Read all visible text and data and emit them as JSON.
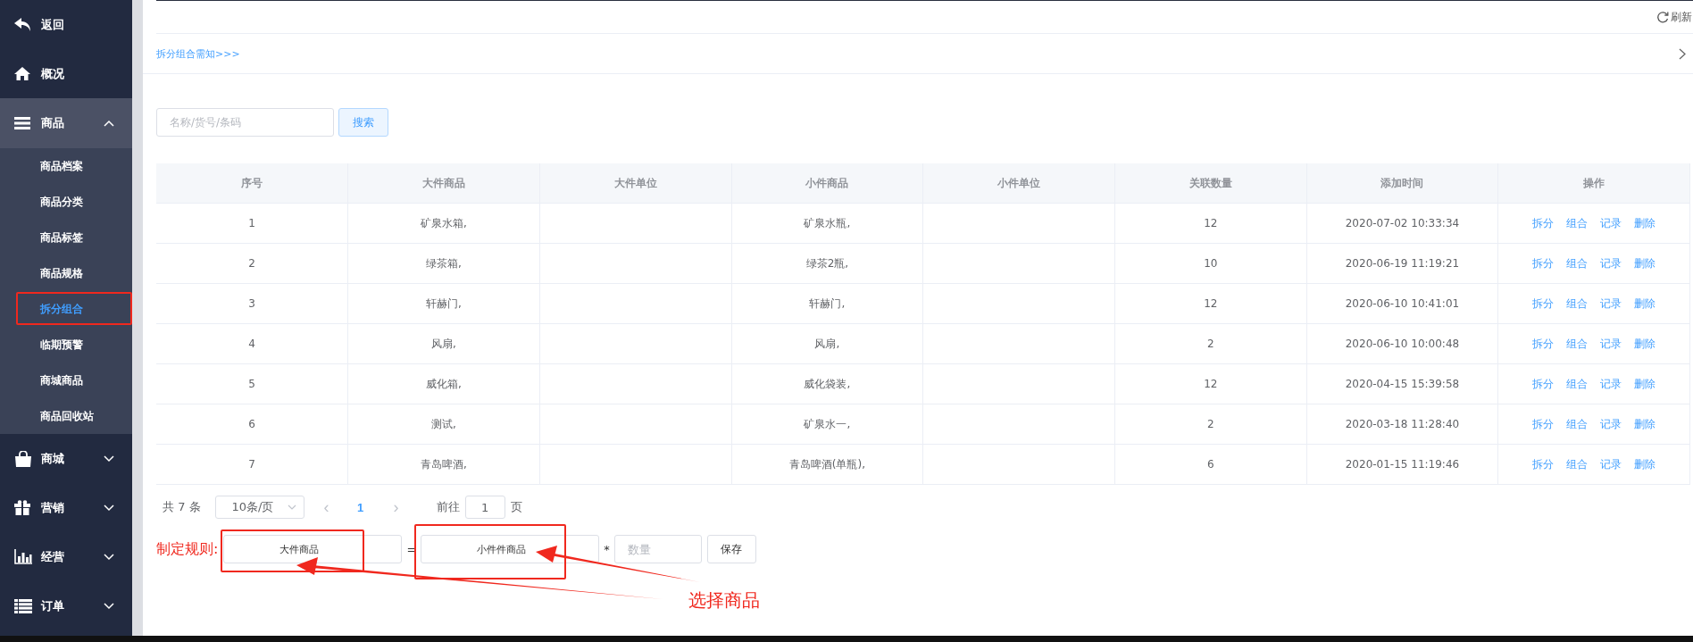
{
  "sidebar": {
    "items": [
      {
        "label": "返回"
      },
      {
        "label": "概况"
      },
      {
        "label": "商品",
        "expanded": true,
        "children": [
          {
            "label": "商品档案",
            "selected": false,
            "marked": false
          },
          {
            "label": "商品分类",
            "selected": false,
            "marked": false
          },
          {
            "label": "商品标签",
            "selected": false,
            "marked": false
          },
          {
            "label": "商品规格",
            "selected": false,
            "marked": false
          },
          {
            "label": "拆分组合",
            "selected": true,
            "marked": true
          },
          {
            "label": "临期预警",
            "selected": false,
            "marked": false
          },
          {
            "label": "商城商品",
            "selected": false,
            "marked": false
          },
          {
            "label": "商品回收站",
            "selected": false,
            "marked": false
          }
        ]
      },
      {
        "label": "商城",
        "expanded": false
      },
      {
        "label": "营销",
        "expanded": false
      },
      {
        "label": "经营",
        "expanded": false
      },
      {
        "label": "订单",
        "expanded": false
      }
    ]
  },
  "toolbar": {
    "refresh": "刷新"
  },
  "notice": {
    "link": "拆分组合需知>>>"
  },
  "search": {
    "placeholder": "名称/货号/条码",
    "button": "搜索"
  },
  "table": {
    "columns": [
      "序号",
      "大件商品",
      "大件单位",
      "小件商品",
      "小件单位",
      "关联数量",
      "添加时间",
      "操作"
    ],
    "rows": [
      {
        "no": "1",
        "big": "矿泉水箱,",
        "small": "矿泉水瓶,",
        "qty": "12",
        "time": "2020-07-02 10:33:34",
        "actions": [
          "拆分",
          "组合",
          "记录",
          "删除"
        ]
      },
      {
        "no": "2",
        "big": "绿茶箱,",
        "small": "绿茶2瓶,",
        "qty": "10",
        "time": "2020-06-19 11:19:21",
        "actions": [
          "拆分",
          "组合",
          "记录",
          "删除"
        ]
      },
      {
        "no": "3",
        "big": "轩赫门,",
        "small": "轩赫门,",
        "qty": "12",
        "time": "2020-06-10 10:41:01",
        "actions": [
          "拆分",
          "组合",
          "记录",
          "删除"
        ]
      },
      {
        "no": "4",
        "big": "风扇,",
        "small": "风扇,",
        "qty": "2",
        "time": "2020-06-10 10:00:48",
        "actions": [
          "拆分",
          "组合",
          "记录",
          "删除"
        ]
      },
      {
        "no": "5",
        "big": "威化箱,",
        "small": "威化袋装,",
        "qty": "12",
        "time": "2020-04-15 15:39:58",
        "actions": [
          "拆分",
          "组合",
          "记录",
          "删除"
        ]
      },
      {
        "no": "6",
        "big": "测试,",
        "small": "矿泉水一,",
        "qty": "2",
        "time": "2020-03-18 11:28:40",
        "actions": [
          "拆分",
          "组合",
          "记录",
          "删除"
        ]
      },
      {
        "no": "7",
        "big": "青岛啤酒,",
        "small": "青岛啤酒(单瓶),",
        "qty": "6",
        "time": "2020-01-15 11:19:46",
        "actions": [
          "拆分",
          "组合",
          "记录",
          "删除"
        ]
      }
    ]
  },
  "pagination": {
    "total": "共 7 条",
    "page_size": "10条/页",
    "prev": "‹",
    "current": "1",
    "next": "›",
    "goto": "前往",
    "goto_value": "1",
    "page_unit": "页"
  },
  "rule": {
    "label": "制定规则:",
    "big_field": {
      "value": "大件商品",
      "marked": true
    },
    "equals": "=",
    "small_field": {
      "value": "小件件商品",
      "marked": true
    },
    "times": "*",
    "qty_placeholder": "数量",
    "save": "保存"
  },
  "annotation": {
    "label": "选择商品"
  }
}
